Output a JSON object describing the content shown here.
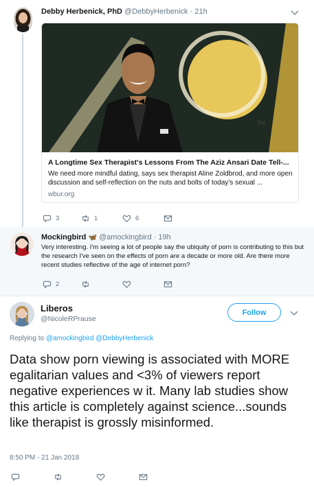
{
  "tweet1": {
    "display_name": "Debby Herbenick, PhD",
    "handle": "@DebbyHerbenick",
    "time": "· 21h",
    "card": {
      "title": "A Longtime Sex Therapist's Lessons From The Aziz Ansari Date Tell-...",
      "description": "We need more mindful dating, says sex therapist Aline Zoldbrod, and more open discussion and self-reflection on the nuts and bolts of today's sexual ...",
      "domain": "wbur.org",
      "image_tm": "TM"
    },
    "actions": {
      "replies": "3",
      "retweets": "1",
      "likes": "6"
    }
  },
  "tweet2": {
    "display_name": "Mockingbird",
    "name_emoji": "🦋",
    "handle": "@amockingbird",
    "time": "· 19h",
    "text": "Very interesting. I'm seeing a lot of people say the ubiquity of porn is contributing to this but the research I've seen on the effects of porn are a decade or more old. Are there more recent studies reflective of the age of internet porn?",
    "actions": {
      "replies": "2"
    }
  },
  "main": {
    "display_name": "Liberos",
    "handle": "@NicoleRPrause",
    "follow_label": "Follow",
    "replying_prefix": "Replying to",
    "replying_to_1": "@amockingbird",
    "replying_to_2": "@DebbyHerbenick",
    "text": "Data show porn viewing is associated with MORE egalitarian values and <3% of viewers report negative experiences w it. Many lab studies show this article is completely against science...sounds like therapist is grossly misinformed.",
    "timestamp": "8:50 PM - 21 Jan 2018"
  },
  "colors": {
    "accent": "#1da1f2",
    "muted": "#657786",
    "reply_background": "#f5f8fa",
    "thread_line": "#ccd6dd"
  },
  "icons": [
    "reply-icon",
    "retweet-icon",
    "like-icon",
    "message-icon",
    "chevron-down-icon",
    "butterfly-emoji"
  ]
}
